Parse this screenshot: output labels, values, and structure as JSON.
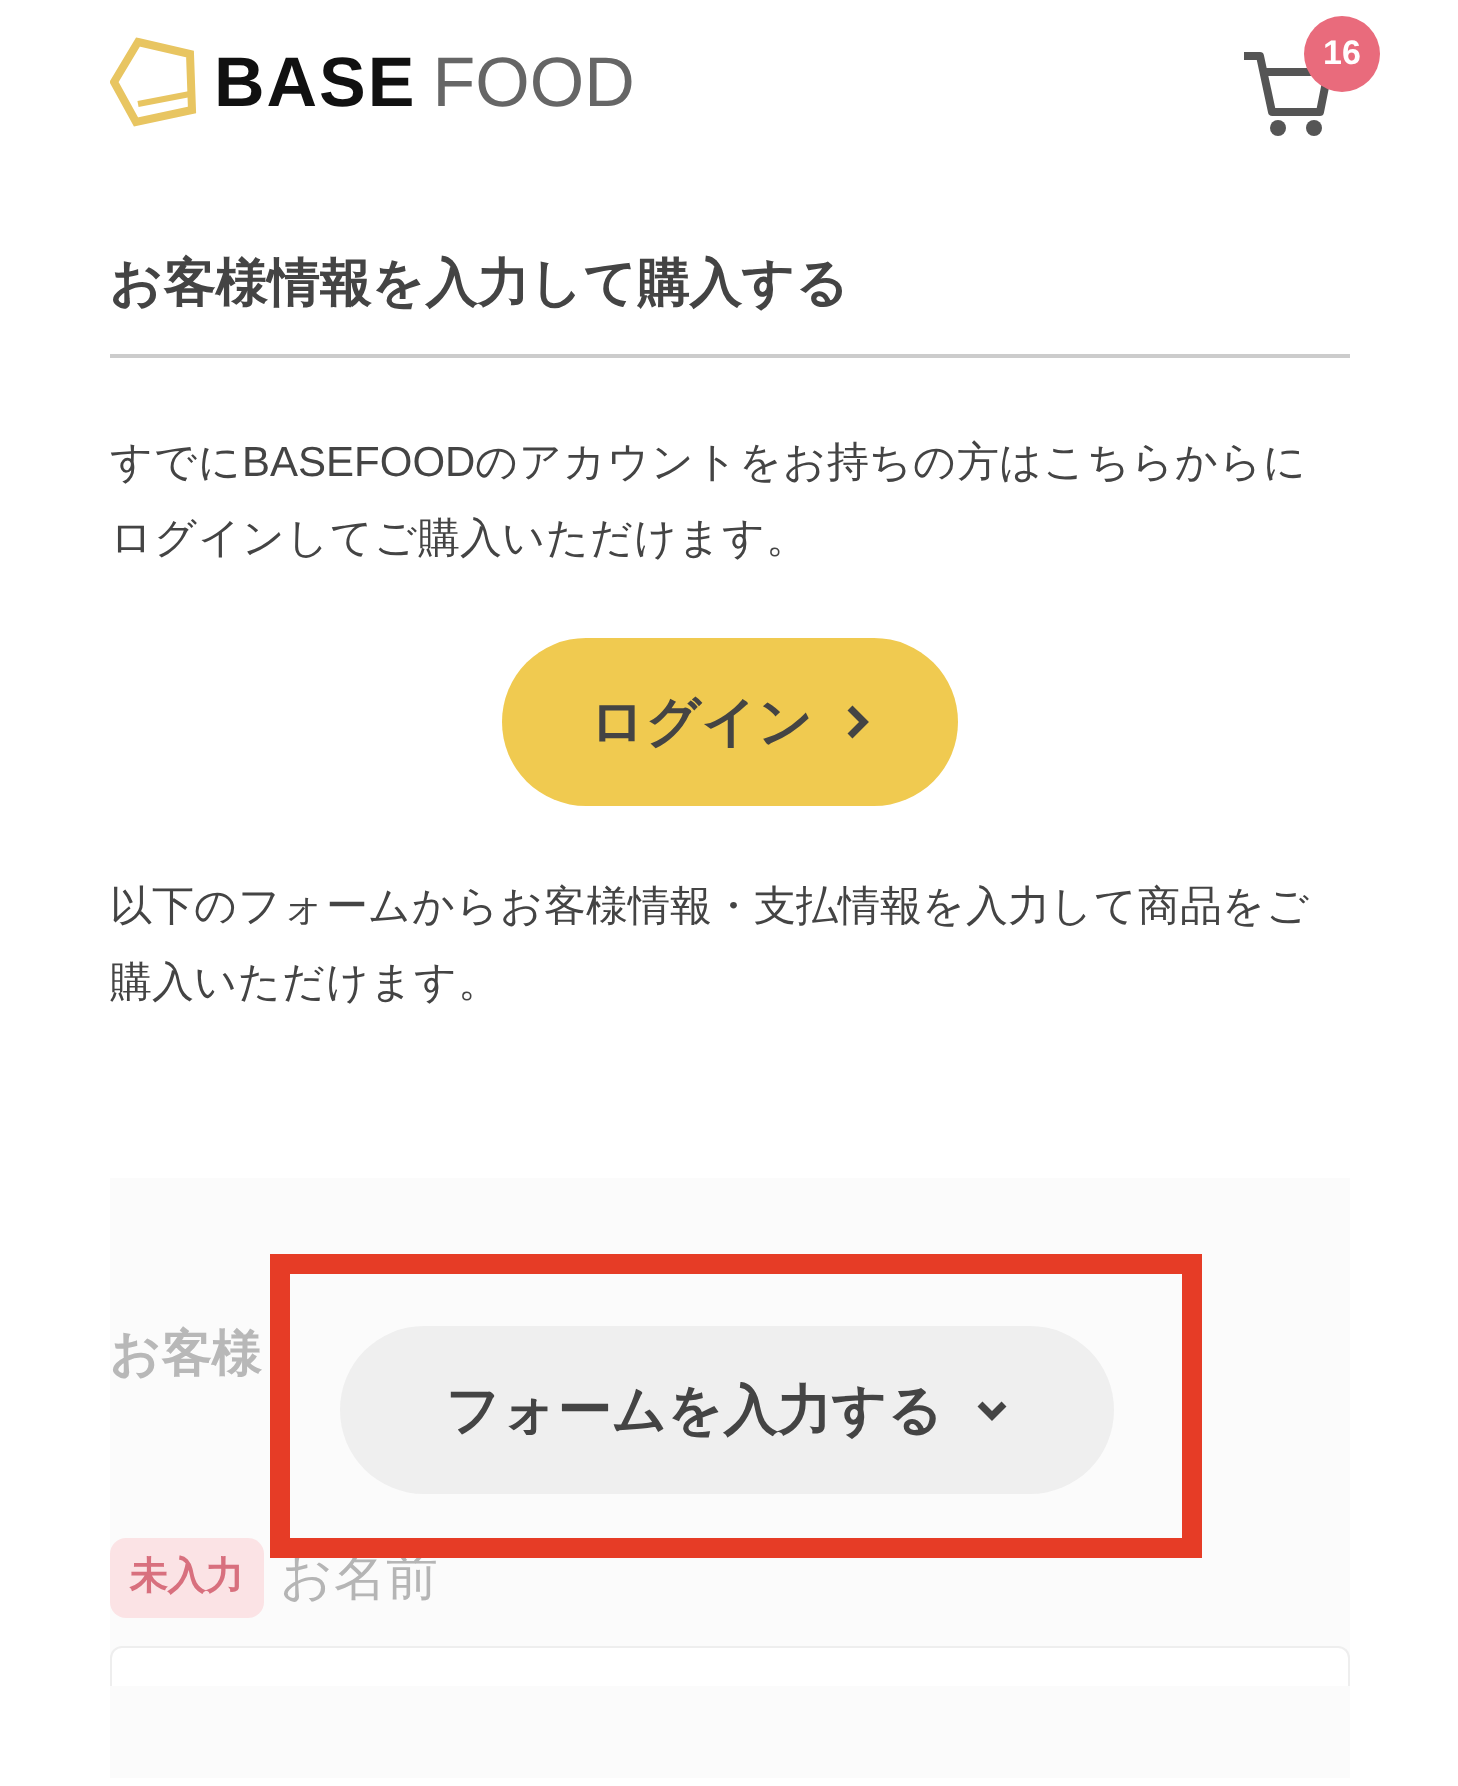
{
  "header": {
    "logo": {
      "bold": "BASE",
      "light": "FOOD"
    },
    "cart": {
      "count": "16"
    }
  },
  "title": "お客様情報を入力して購入する",
  "intro": "すでにBASEFOODのアカウントをお持ちの方はこちらからにログインしてご購入いただけます。",
  "login_button": "ログイン",
  "form_note": "以下のフォームからお客様情報・支払情報を入力して商品をご購入いただけます。",
  "form_section": {
    "heading": "お客様",
    "expand_button": "フォームを入力する",
    "highlighted": true,
    "fields": [
      {
        "label": "お名前",
        "status": "未入力"
      }
    ]
  }
}
